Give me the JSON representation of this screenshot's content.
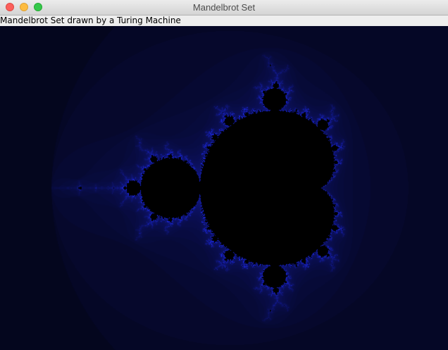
{
  "window": {
    "title": "Mandelbrot Set",
    "controls": [
      "close",
      "minimize",
      "zoom"
    ]
  },
  "label": {
    "text": "Mandelbrot Set drawn by a Turing Machine"
  },
  "render": {
    "colors": {
      "inside": "#000000",
      "background": "#02030f",
      "edge": "#1f2cff"
    },
    "view": {
      "re_min": -2.43,
      "re_max": 1.33,
      "im_min": -1.36,
      "im_max": 1.36
    },
    "max_iterations": 100
  }
}
